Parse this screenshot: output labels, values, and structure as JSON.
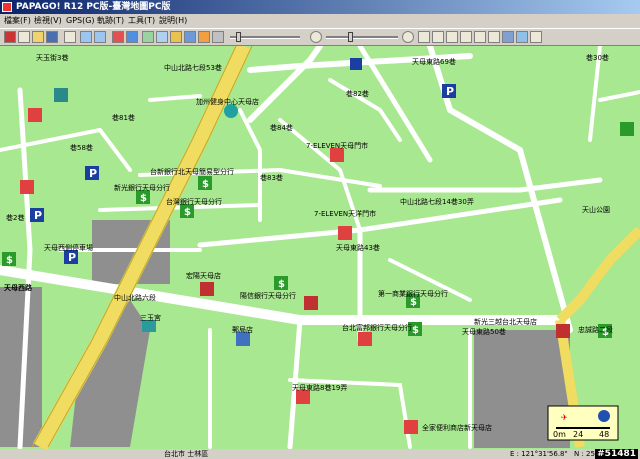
{
  "window": {
    "title": "PAPAGO! R12 PC版-臺灣地圖PC版"
  },
  "menu": [
    "檔案(F)",
    "檢視(V)",
    "GPS(G)",
    "軌跡(T)",
    "工具(T)",
    "說明(H)"
  ],
  "map": {
    "labels": {
      "zhongshan_n7_53": "中山北路七段53巷",
      "jiayang_center": "加州健身中心天母店",
      "seven_tianmen": "7-ELEVEN天母門市",
      "seven_tianyang": "7-ELEVEN天洋門市",
      "taixin_bank": "台新銀行北天母簡易型分行",
      "shinkong_bank": "新光銀行天母分行",
      "taiwan_bank": "台灣銀行天母分行",
      "tianmu_west_parking": "天母西側停車場",
      "tianmu_west_rd": "天母西路",
      "zhongshan_n6": "中山北路六段",
      "sanyu_temple": "三玉宮",
      "post_office": "郵局店",
      "hongyang": "宏陽天母店",
      "yushan_bank": "陽信銀行天母分行",
      "first_bank": "第一商業銀行天母分行",
      "taipei_fubon": "台北富邦銀行天母分行",
      "xinguang_sanyue": "新光三越台北天母店",
      "tianmu_e_8_19": "天母東路8巷19弄",
      "quanjia": "全家便利商店新天母店",
      "zhongshan_n7_14_30": "中山北路七段14巷30弄",
      "tianshan_park": "天山公園",
      "zhongshan_n7": "中山北路七段",
      "lane_81": "巷81巷",
      "lane_82": "巷82巷",
      "lane_83": "巷83巷",
      "tianmu_e_43": "天母東路43巷",
      "tianmu_e_50": "天母東路50巷",
      "tianmu_e_69": "天母東路69巷",
      "zhongcheng": "忠誠路二段",
      "lane_30": "巷30巷",
      "tian_yu": "天玉街3巷",
      "lane_58": "巷58巷",
      "lane_84": "巷84巷",
      "lane_2": "巷2巷"
    }
  },
  "scale": {
    "zero": "0m",
    "mid": "24",
    "end": "48"
  },
  "status": {
    "district": "台北市 士林區",
    "coord_e": "E : 121°31'56.8\"",
    "coord_n": "N : 25°07'",
    "watermark": "#51481"
  },
  "colors": {
    "map_bg": "#a8e890",
    "road": "#ffffff",
    "main_road": "#f0dc60",
    "building": "#8f8f8f"
  }
}
